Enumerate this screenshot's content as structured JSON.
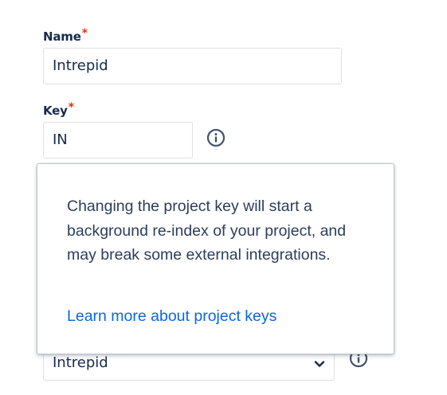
{
  "form": {
    "name": {
      "label": "Name",
      "required_mark": "*",
      "value": "Intrepid"
    },
    "key": {
      "label": "Key",
      "required_mark": "*",
      "value": "IN",
      "info_icon": "info-icon"
    },
    "select": {
      "value": "Intrepid",
      "chevron_icon": "chevron-down-icon",
      "info_icon": "info-icon"
    }
  },
  "popover": {
    "message": "Changing the project key will start a background re-index of your project, and may break some external integrations.",
    "link_label": "Learn more about project keys"
  },
  "colors": {
    "text": "#172b4d",
    "required": "#de350b",
    "link": "#0c66e4",
    "border": "#dfe1e6",
    "icon": "#42526e"
  }
}
